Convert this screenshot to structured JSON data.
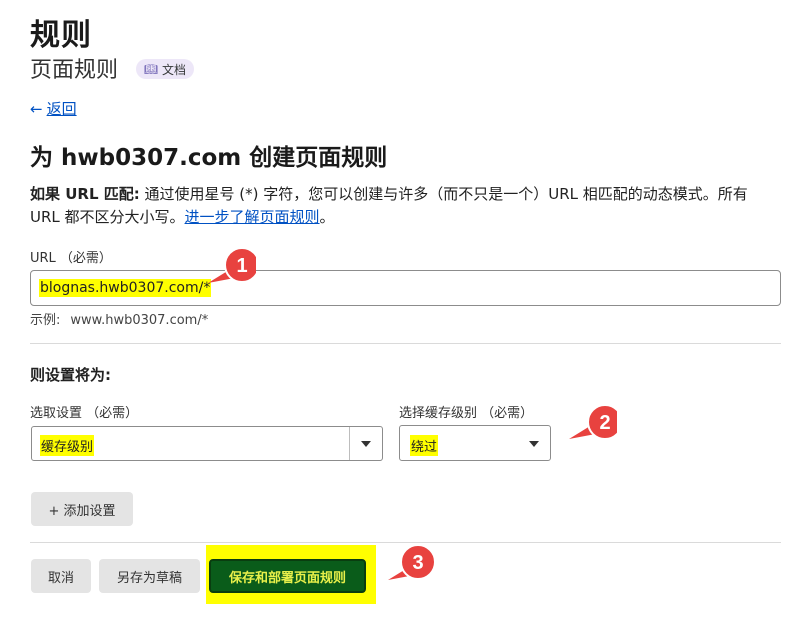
{
  "page": {
    "title": "规则",
    "subtitle": "页面规则",
    "docs_badge": "文档",
    "back_label": "返回",
    "heading": "为 hwb0307.com 创建页面规则",
    "description": {
      "bold": "如果 URL 匹配:",
      "text": " 通过使用星号 (*) 字符，您可以创建与许多（而不只是一个）URL 相匹配的动态模式。所有 URL 都不区分大小写。",
      "link": "进一步了解页面规则",
      "end": "。"
    }
  },
  "url_field": {
    "label": "URL （必需）",
    "value": "blognas.hwb0307.com/*",
    "example_label": "示例:",
    "example_value": "www.hwb0307.com/*"
  },
  "settings": {
    "heading": "则设置将为:",
    "pick_label": "选取设置 （必需）",
    "pick_value": "缓存级别",
    "cache_label": "选择缓存级别 （必需）",
    "cache_value": "绕过",
    "add_setting_label": "+ 添加设置"
  },
  "actions": {
    "cancel": "取消",
    "save_draft": "另存为草稿",
    "save_deploy": "保存和部署页面规则"
  },
  "annotations": {
    "marker1": "1",
    "marker2": "2",
    "marker3": "3",
    "marker_color": "#e8423f",
    "highlight_color": "#ffff00"
  },
  "colors": {
    "link": "#0051c3",
    "badge_bg": "#ede7f8",
    "save_button_bg": "#0a5c1a"
  },
  "icons": {
    "back": "arrow-left-icon",
    "docs": "book-icon",
    "dropdown": "caret-down-icon"
  }
}
